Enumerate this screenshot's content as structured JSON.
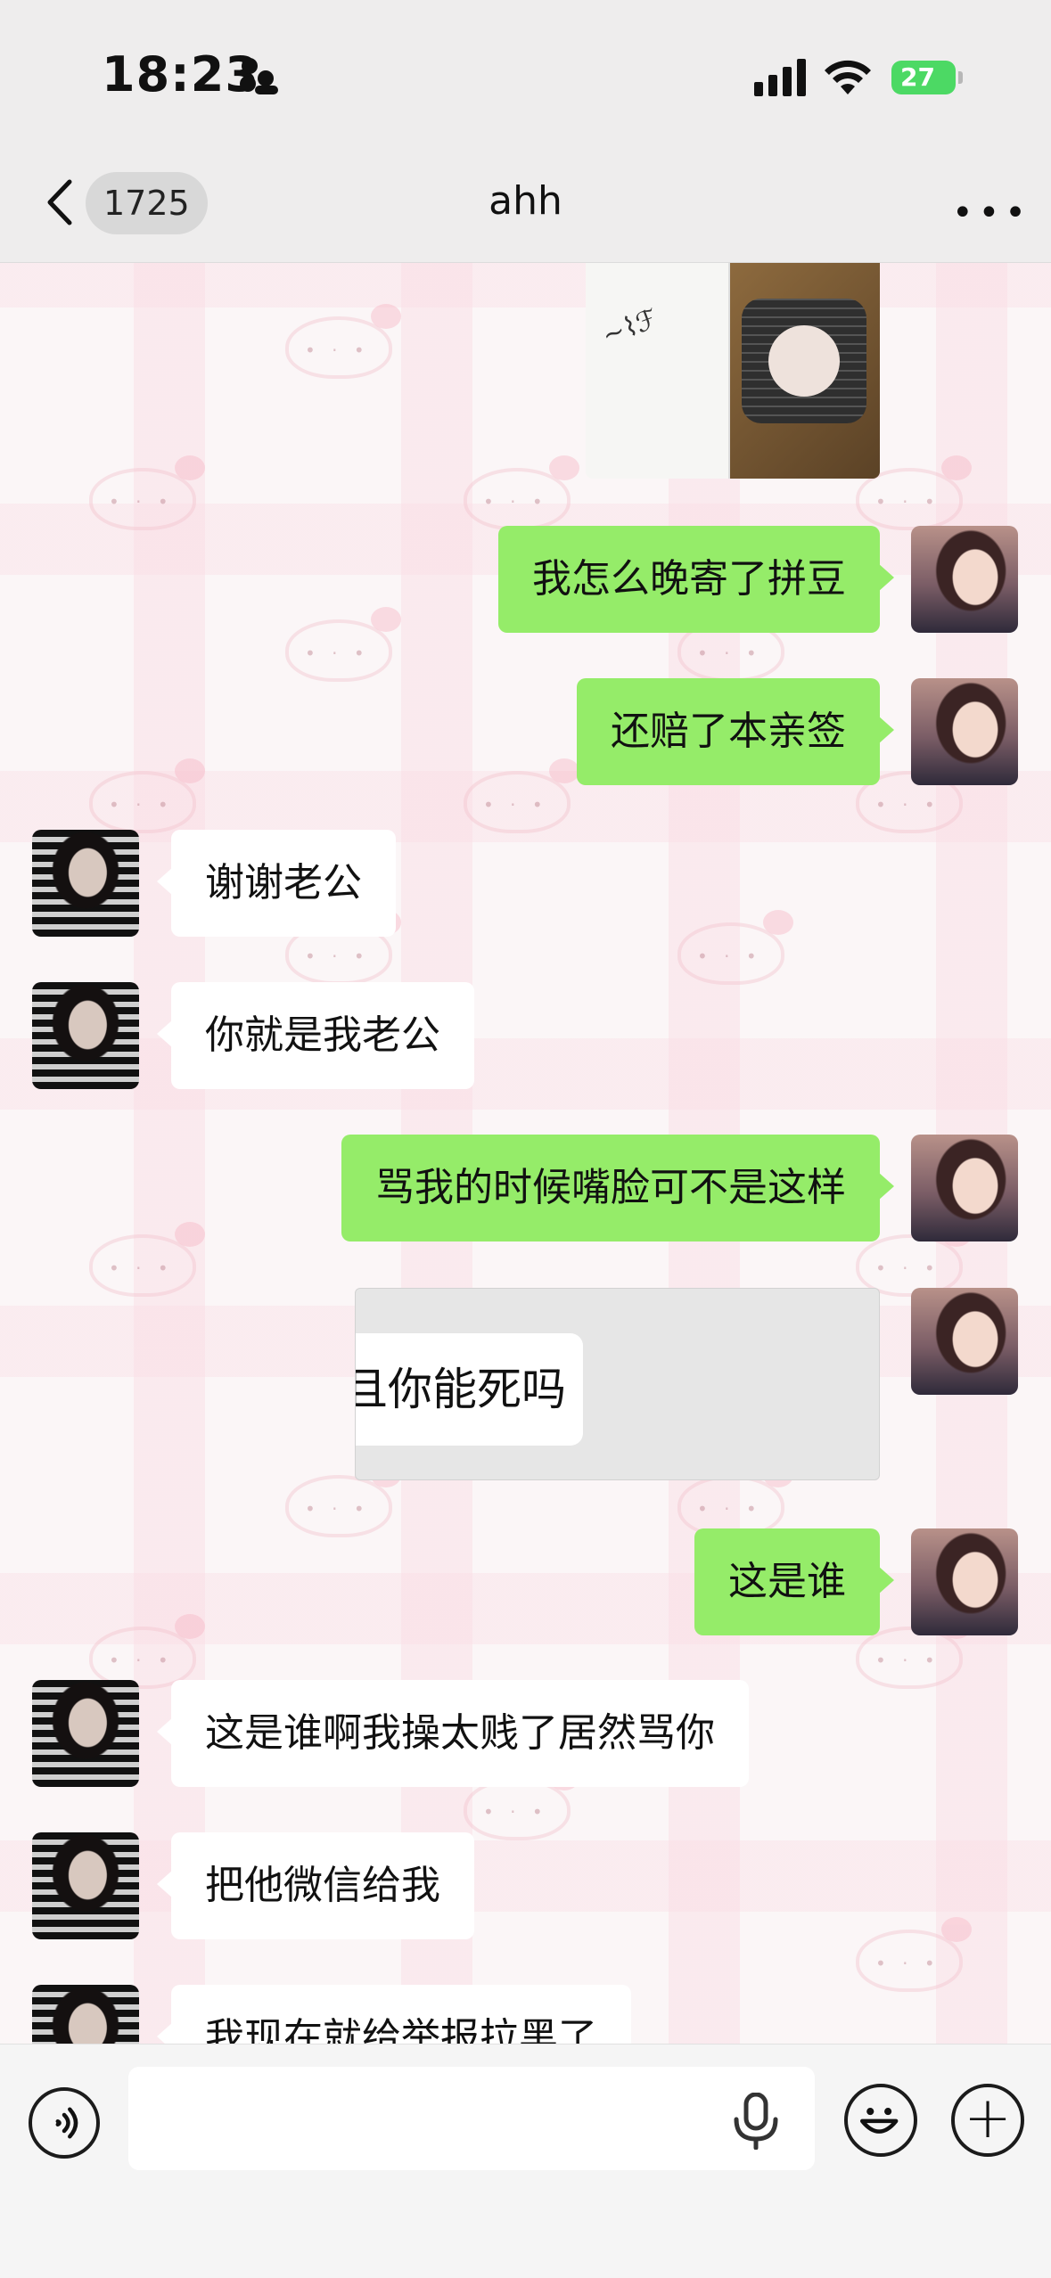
{
  "status_bar": {
    "time": "18:23",
    "battery_level": "27",
    "icons": [
      "signal-icon",
      "wifi-icon",
      "battery-charging-icon"
    ]
  },
  "nav": {
    "unread_count": "1725",
    "title": "ahh",
    "more_label": "•••"
  },
  "messages": [
    {
      "side": "out",
      "type": "image",
      "icon": "photo-icon"
    },
    {
      "side": "out",
      "type": "text",
      "text": "我怎么晚寄了拼豆"
    },
    {
      "side": "out",
      "type": "text",
      "text": "还赔了本亲签"
    },
    {
      "side": "in",
      "type": "text",
      "text": "谢谢老公"
    },
    {
      "side": "in",
      "type": "text",
      "text": "你就是我老公"
    },
    {
      "side": "out",
      "type": "text",
      "text": "骂我的时候嘴脸可不是这样"
    },
    {
      "side": "out",
      "type": "image",
      "text": "且你能死吗"
    },
    {
      "side": "out",
      "type": "text",
      "text": "这是谁"
    },
    {
      "side": "in",
      "type": "text",
      "text": "这是谁啊我操太贱了居然骂你"
    },
    {
      "side": "in",
      "type": "text",
      "text": "把他微信给我"
    },
    {
      "side": "in",
      "type": "text",
      "text": "我现在就给举报拉黑了"
    }
  ],
  "input_bar": {
    "placeholder": "",
    "icons": [
      "voice-icon",
      "mic-icon",
      "emoji-icon",
      "plus-icon"
    ]
  },
  "colors": {
    "outgoing_bubble": "#95ec69",
    "incoming_bubble": "#ffffff",
    "battery": "#4cd964"
  }
}
